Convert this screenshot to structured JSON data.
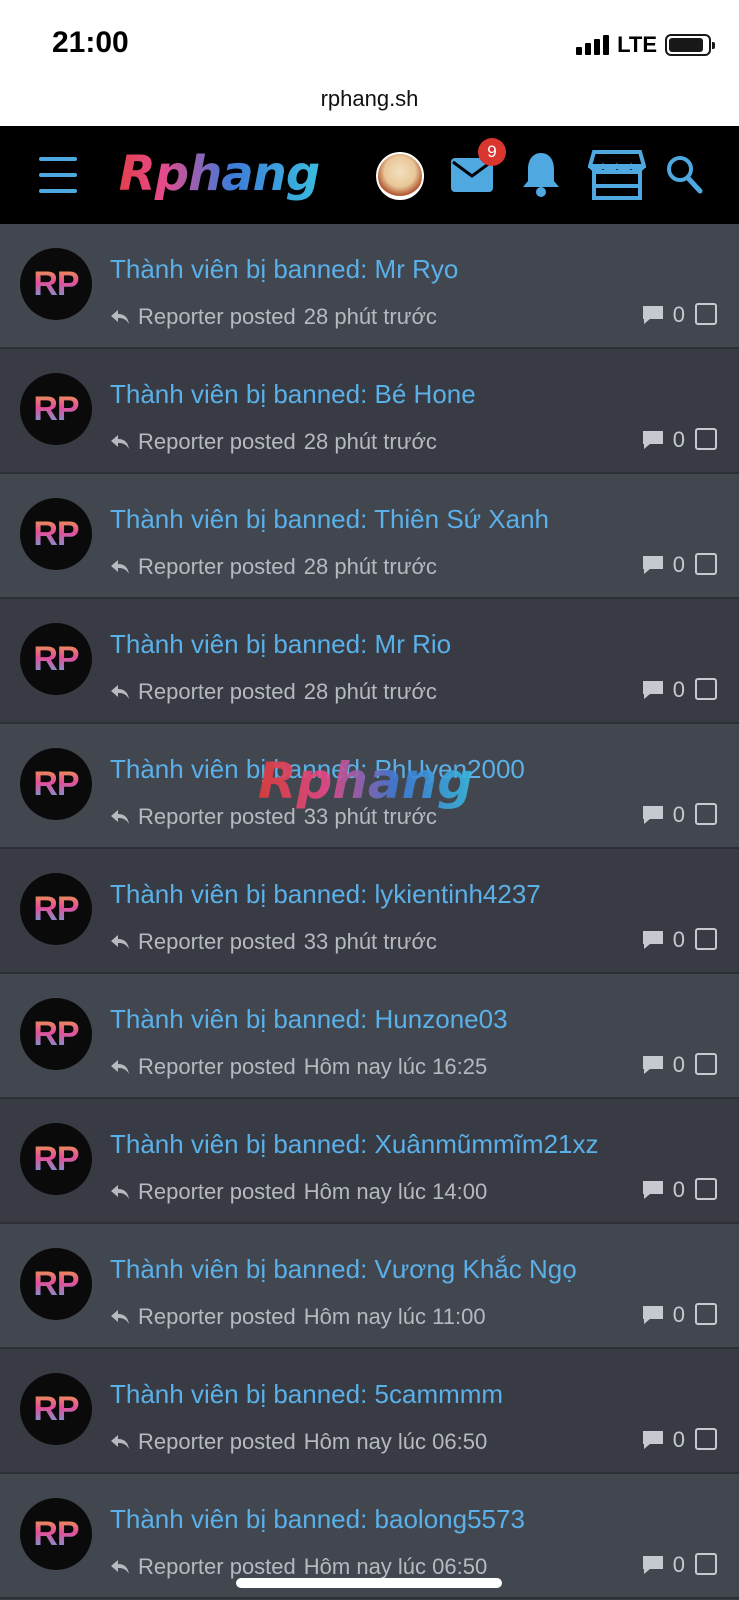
{
  "status_bar": {
    "time": "21:00",
    "network": "LTE"
  },
  "browser": {
    "url": "rphang.sh"
  },
  "header": {
    "logo_text": "Rphang",
    "mail_badge": "9",
    "icons": [
      "menu-icon",
      "user-avatar",
      "mail-icon",
      "bell-icon",
      "store-icon",
      "search-icon"
    ]
  },
  "watermark": "Rphang",
  "threads": [
    {
      "avatar": "RP",
      "title": "Thành viên bị banned: Mr Ryo",
      "author": "Reporter posted",
      "time": "28 phút trước",
      "replies": "0"
    },
    {
      "avatar": "RP",
      "title": "Thành viên bị banned: Bé Hone",
      "author": "Reporter posted",
      "time": "28 phút trước",
      "replies": "0"
    },
    {
      "avatar": "RP",
      "title": "Thành viên bị banned: Thiên Sứ Xanh",
      "author": "Reporter posted",
      "time": "28 phút trước",
      "replies": "0"
    },
    {
      "avatar": "RP",
      "title": "Thành viên bị banned: Mr Rio",
      "author": "Reporter posted",
      "time": "28 phút trước",
      "replies": "0"
    },
    {
      "avatar": "RP",
      "title": "Thành viên bị banned: PhUyen2000",
      "author": "Reporter posted",
      "time": "33 phút trước",
      "replies": "0"
    },
    {
      "avatar": "RP",
      "title": "Thành viên bị banned: lykientinh4237",
      "author": "Reporter posted",
      "time": "33 phút trước",
      "replies": "0"
    },
    {
      "avatar": "RP",
      "title": "Thành viên bị banned: Hunzone03",
      "author": "Reporter posted",
      "time": "Hôm nay lúc 16:25",
      "replies": "0"
    },
    {
      "avatar": "RP",
      "title": "Thành viên bị banned: Xuânmũmmĩm21xz",
      "author": "Reporter posted",
      "time": "Hôm nay lúc 14:00",
      "replies": "0"
    },
    {
      "avatar": "RP",
      "title": "Thành viên bị banned: Vương Khắc Ngọ",
      "author": "Reporter posted",
      "time": "Hôm nay lúc 11:00",
      "replies": "0"
    },
    {
      "avatar": "RP",
      "title": "Thành viên bị banned: 5cammmm",
      "author": "Reporter posted",
      "time": "Hôm nay lúc 06:50",
      "replies": "0"
    },
    {
      "avatar": "RP",
      "title": "Thành viên bị banned: baolong5573",
      "author": "Reporter posted",
      "time": "Hôm nay lúc 06:50",
      "replies": "0"
    }
  ],
  "colors": {
    "nav_bg": "#000000",
    "accent": "#5ab0e8",
    "badge": "#d9362f",
    "row_light": "#42464f",
    "row_dark": "#383b43"
  }
}
